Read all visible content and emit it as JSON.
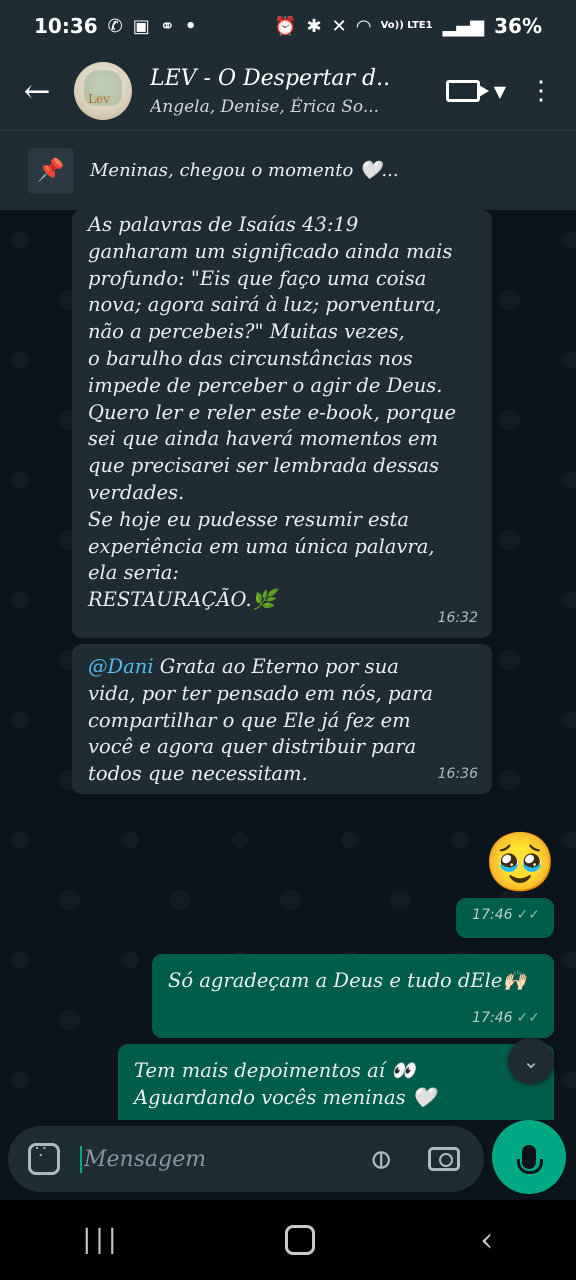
{
  "status_bar": {
    "time": "10:36",
    "left_icons": [
      "whatsapp-icon",
      "image-icon",
      "link-icon",
      "dot-icon"
    ],
    "right_icons": [
      "alarm-icon",
      "bluetooth-icon",
      "mute-icon",
      "wifi-icon",
      "volte-icon",
      "signal-icon"
    ],
    "volte": "Vo)) LTE1",
    "battery": "36%"
  },
  "header": {
    "title": "LEV - O Despertar d...",
    "subtitle": "Angela, Denise, Érica So..."
  },
  "pinned": {
    "text": "Meninas, chegou o momento 🤍..."
  },
  "messages": [
    {
      "type": "incoming",
      "text": "As palavras de Isaías 43:19\nganharam um significado ainda mais\nprofundo: \"Eis que faço uma coisa\nnova; agora sairá à luz; porventura,\nnão a percebeis?\" Muitas vezes,\no barulho das circunstâncias nos\nimpede de perceber o agir de Deus.\nQuero ler e reler este e-book, porque\nsei que ainda haverá momentos em\nque precisarei ser lembrada dessas\nverdades.\nSe hoje eu pudesse resumir esta\nexperiência em uma única palavra,\nela seria:\nRESTAURAÇÃO.🌿",
      "time": "16:32"
    },
    {
      "type": "incoming",
      "mention": "@Dani",
      "text": " Grata ao Eterno por sua\nvida, por ter pensado em nós,  para\ncompartilhar  o que Ele já fez em\nvocê e agora quer distribuir para\ntodos que necessitam.",
      "time": "16:36"
    },
    {
      "type": "outgoing",
      "emoji": "🥹",
      "time": "17:46",
      "ticks": "✓✓"
    },
    {
      "type": "outgoing",
      "text": "Só agradeçam a Deus e tudo dEle🙌🏻",
      "time": "17:46",
      "ticks": "✓✓"
    },
    {
      "type": "outgoing",
      "text": "Tem mais depoimentos aí 👀\nAguardando vocês meninas 🤍"
    }
  ],
  "input": {
    "placeholder": "Mensagem"
  },
  "colors": {
    "background": "#0b141a",
    "header": "#1f2c34",
    "incoming_bubble": "#1f2c34",
    "outgoing_bubble": "#005c4b",
    "accent": "#00a884",
    "mention": "#53bdeb"
  }
}
